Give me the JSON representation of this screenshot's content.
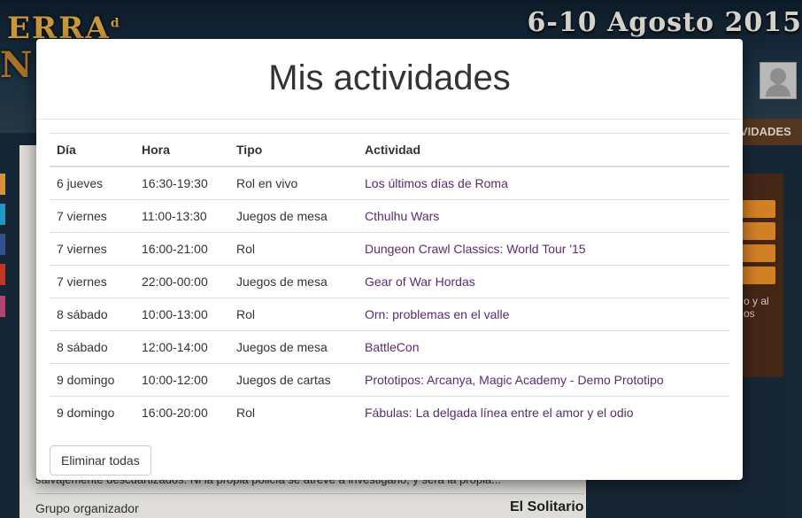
{
  "background": {
    "logo_text": "ERRA",
    "logo_superscript": "d",
    "logo_second_line": "N",
    "dates": "6-10 Agosto 2015",
    "nav_item": "VIDADES",
    "description": "salvajemente descuartizados. Ni la propia policía se atreve a investigarlo, y será la propia...",
    "organizer_label": "Grupo organizador",
    "organizer_value": "El Solitario",
    "side_text": "o y al os"
  },
  "modal": {
    "title": "Mis actividades",
    "columns": [
      "Día",
      "Hora",
      "Tipo",
      "Actividad"
    ],
    "rows": [
      {
        "dia": "6 jueves",
        "hora": "16:30-19:30",
        "tipo": "Rol en vivo",
        "actividad": "Los últimos días de Roma"
      },
      {
        "dia": "7 viernes",
        "hora": "11:00-13:30",
        "tipo": "Juegos de mesa",
        "actividad": "Cthulhu Wars"
      },
      {
        "dia": "7 viernes",
        "hora": "16:00-21:00",
        "tipo": "Rol",
        "actividad": "Dungeon Crawl Classics: World Tour '15"
      },
      {
        "dia": "7 viernes",
        "hora": "22:00-00:00",
        "tipo": "Juegos de mesa",
        "actividad": "Gear of War Hordas"
      },
      {
        "dia": "8 sábado",
        "hora": "10:00-13:00",
        "tipo": "Rol",
        "actividad": "Orn: problemas en el valle"
      },
      {
        "dia": "8 sábado",
        "hora": "12:00-14:00",
        "tipo": "Juegos de mesa",
        "actividad": "BattleCon"
      },
      {
        "dia": "9 domingo",
        "hora": "10:00-12:00",
        "tipo": "Juegos de cartas",
        "actividad": "Prototipos: Arcanya, Magic Academy - Demo Prototipo"
      },
      {
        "dia": "9 domingo",
        "hora": "16:00-20:00",
        "tipo": "Rol",
        "actividad": "Fábulas: La delgada línea entre el amor y el odio"
      }
    ],
    "delete_all_label": "Eliminar todas"
  },
  "colors": {
    "link": "#5b2b6e",
    "accent_orange": "#e58a2a",
    "nav_brown": "#5b3b22"
  },
  "icons": {
    "avatar": "user-placeholder-icon"
  }
}
